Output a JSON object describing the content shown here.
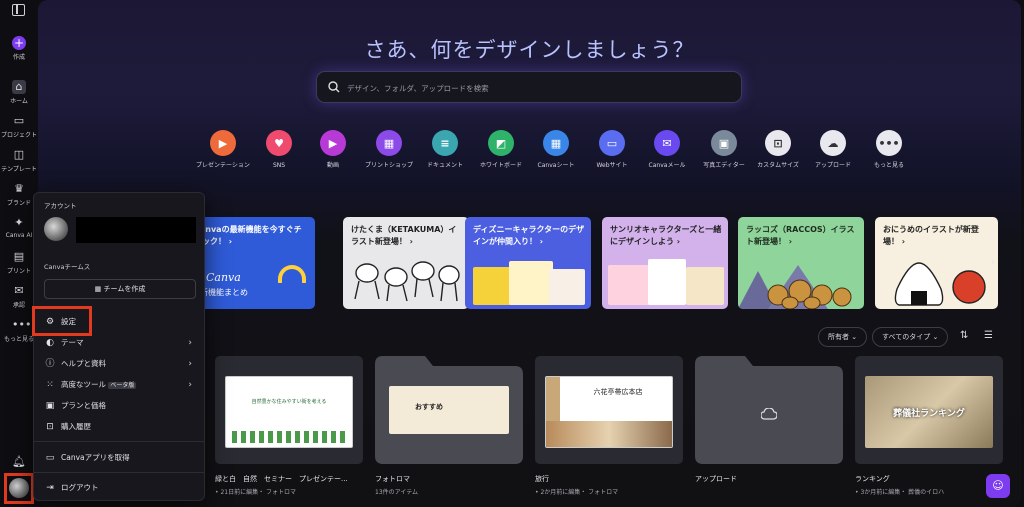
{
  "rail": {
    "create": "作成",
    "home": "ホーム",
    "projects": "プロジェクト",
    "templates": "テンプレート",
    "brand": "ブランド",
    "canva_ai": "Canva AI",
    "print": "プリント",
    "approval": "承認",
    "more": "もっと見る"
  },
  "headline": "さあ、何をデザインしましょう？",
  "search": {
    "placeholder": "デザイン、フォルダ、アップロードを検索"
  },
  "quick_actions": [
    {
      "label": "プレゼンテーション",
      "color": "#ef6a3a",
      "icon": "presentation-icon"
    },
    {
      "label": "SNS",
      "color": "#ef4b6e",
      "icon": "heart-icon"
    },
    {
      "label": "動画",
      "color": "#b83ad6",
      "icon": "video-icon"
    },
    {
      "label": "プリントショップ",
      "color": "#8c4ae8",
      "icon": "print-icon"
    },
    {
      "label": "ドキュメント",
      "color": "#3aa6b0",
      "icon": "document-icon"
    },
    {
      "label": "ホワイトボード",
      "color": "#2fb36a",
      "icon": "whiteboard-icon"
    },
    {
      "label": "Canvaシート",
      "color": "#3a86e8",
      "icon": "sheet-icon"
    },
    {
      "label": "Webサイト",
      "color": "#5a6cf0",
      "icon": "website-icon"
    },
    {
      "label": "Canvaメール",
      "color": "#6a4af0",
      "icon": "mail-icon"
    },
    {
      "label": "写真エディター",
      "color": "#7a8a9a",
      "icon": "photo-icon"
    },
    {
      "label": "カスタムサイズ",
      "color": "#e8e8ee",
      "icon": "custom-size-icon"
    },
    {
      "label": "アップロード",
      "color": "#e8e8ee",
      "icon": "upload-icon"
    },
    {
      "label": "もっと見る",
      "color": "#e8e8ee",
      "icon": "more-icon"
    }
  ],
  "banners": [
    {
      "title": "Canvaの最新機能を今すぐチェック！ ›",
      "sub": "新機能まとめ",
      "bg": "#2f5bd8"
    },
    {
      "title": "けたくま（KETAKUMA）イラスト新登場！ ›",
      "bg": "#e8e8ea"
    },
    {
      "title": "ディズニーキャラクターのデザインが仲間入り！ ›",
      "bg": "#4b5fe0"
    },
    {
      "title": "サンリオキャラクターズと一緒にデザインしよう ›",
      "bg": "#d3b2ec"
    },
    {
      "title": "ラッコズ（RACCOS）イラスト新登場！ ›",
      "bg": "#8fd49a"
    },
    {
      "title": "おにうめのイラストが新登場！ ›",
      "bg": "#f7f0e0"
    }
  ],
  "filters": {
    "owner": "所有者",
    "type": "すべてのタイプ"
  },
  "cards": [
    {
      "title": "緑と白　自然　セミナー　プレゼンテー...",
      "meta": "• 21日前に編集・ フォトロマ",
      "thumb_text": "自然豊かな住みやすい街を考える"
    },
    {
      "title": "フォトロマ",
      "meta": "13件のアイテム",
      "thumb_text": "おすすめ"
    },
    {
      "title": "旅行",
      "meta": "• 2か月前に編集・ フォトロマ",
      "thumb_text": "六花亭帯広本店"
    },
    {
      "title": "アップロード",
      "meta": ""
    },
    {
      "title": "ランキング",
      "meta": "• 3か月前に編集・ 葬儀のイロハ",
      "thumb_text": "葬儀社ランキング"
    }
  ],
  "menu": {
    "account": "アカウント",
    "teams": "Canvaチームス",
    "create_team": "チームを作成",
    "settings": "設定",
    "theme": "テーマ",
    "help": "ヘルプと資料",
    "advanced": "高度なツール",
    "beta": "ベータ版",
    "plans": "プランと価格",
    "purchase": "購入履歴",
    "get_app": "Canvaアプリを取得",
    "logout": "ログアウト"
  }
}
